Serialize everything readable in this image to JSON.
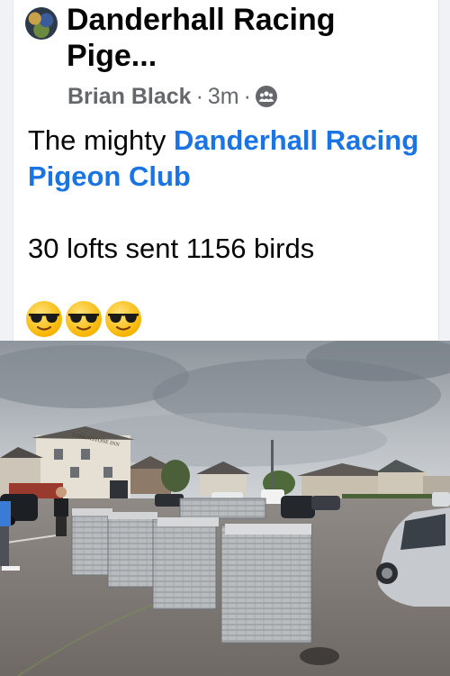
{
  "post": {
    "group_name": "Danderhall  Racing Pige...",
    "author": "Brian Black",
    "separator": "·",
    "time": "3m",
    "text_prefix": "The mighty ",
    "mention": "Danderhall Racing Pigeon Club",
    "stat_line": "30 lofts sent 1156 birds",
    "emojis": [
      "smiling-face-with-sunglasses",
      "smiling-face-with-sunglasses",
      "smiling-face-with-sunglasses"
    ]
  },
  "photo": {
    "inn_sign": "EDMONSTONE INN"
  },
  "colors": {
    "mention": "#1b74e4",
    "meta": "#65676b",
    "text": "#050505"
  }
}
